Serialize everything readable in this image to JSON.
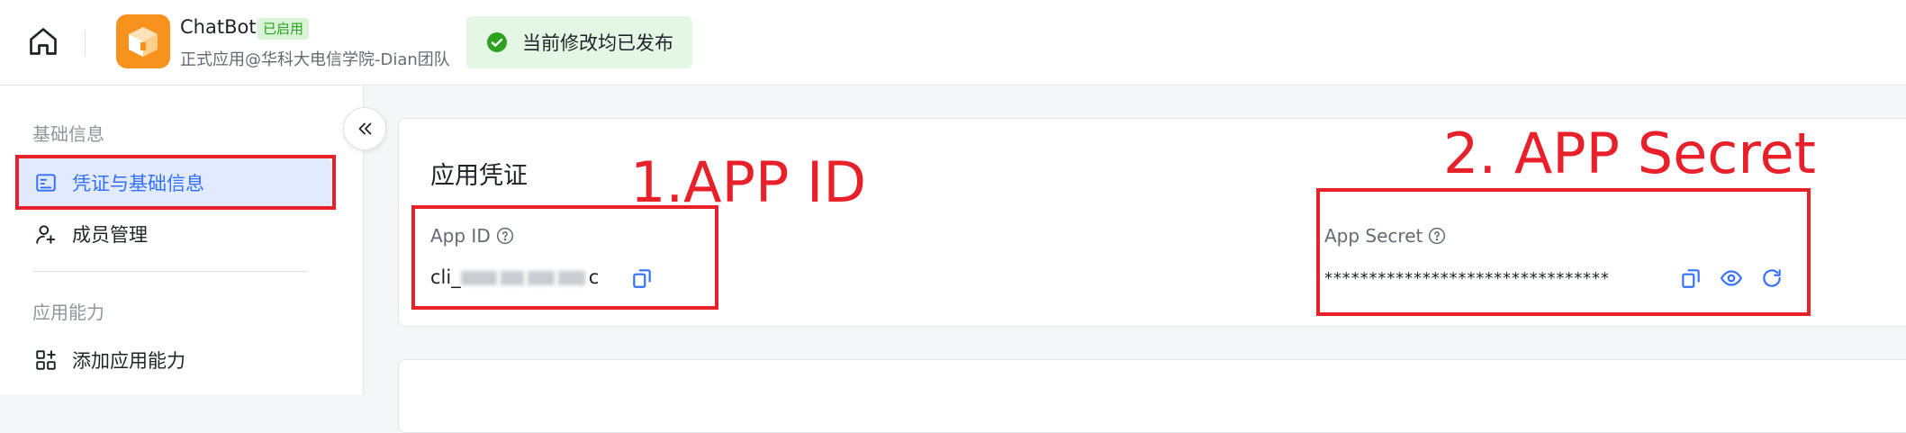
{
  "header": {
    "app_name": "ChatBot",
    "status": "已启用",
    "org": "正式应用@华科大电信学院-Dian团队",
    "publish_message": "当前修改均已发布"
  },
  "sidebar": {
    "section_basic": "基础信息",
    "items_basic": [
      {
        "label": "凭证与基础信息",
        "icon": "credential-icon",
        "active": true
      },
      {
        "label": "成员管理",
        "icon": "member-add-icon",
        "active": false
      }
    ],
    "section_ability": "应用能力",
    "items_ability": [
      {
        "label": "添加应用能力",
        "icon": "add-ability-icon",
        "active": false
      }
    ]
  },
  "credentials": {
    "title": "应用凭证",
    "app_id_label": "App ID",
    "app_id_value_visible_prefix": "cli_",
    "app_id_value_visible_suffix": "c",
    "app_secret_label": "App Secret",
    "app_secret_value": "********************************"
  },
  "annotations": {
    "app_id": "1.APP ID",
    "app_secret": "2. APP Secret"
  },
  "colors": {
    "accent": "#3370ff",
    "active_bg": "#e1eaff",
    "success": "#2ea121",
    "annotation_red": "#e8202a",
    "logo_orange": "#f7921e"
  }
}
